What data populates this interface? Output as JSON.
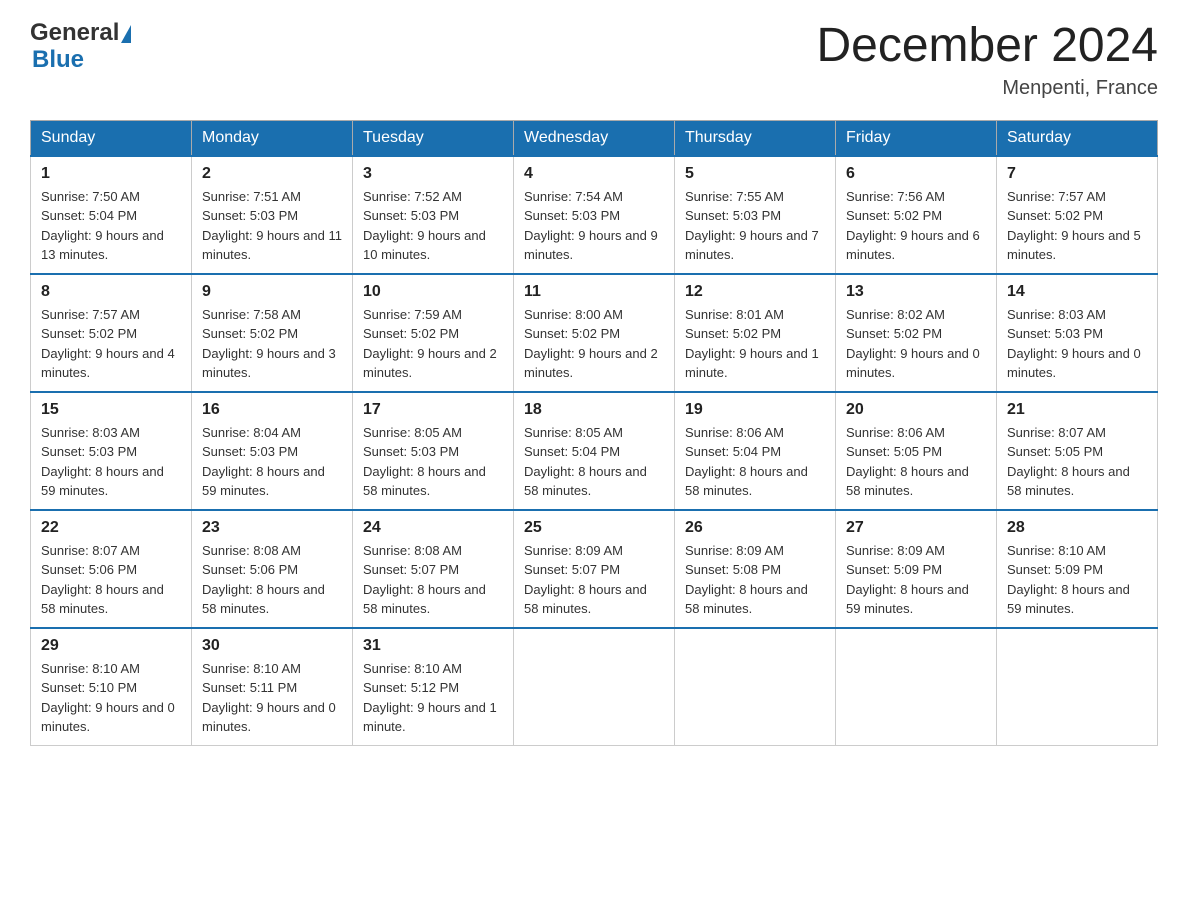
{
  "header": {
    "logo_text_general": "General",
    "logo_text_blue": "Blue",
    "title": "December 2024",
    "location": "Menpenti, France"
  },
  "days_of_week": [
    "Sunday",
    "Monday",
    "Tuesday",
    "Wednesday",
    "Thursday",
    "Friday",
    "Saturday"
  ],
  "weeks": [
    [
      {
        "date": "1",
        "sunrise": "7:50 AM",
        "sunset": "5:04 PM",
        "daylight": "9 hours and 13 minutes."
      },
      {
        "date": "2",
        "sunrise": "7:51 AM",
        "sunset": "5:03 PM",
        "daylight": "9 hours and 11 minutes."
      },
      {
        "date": "3",
        "sunrise": "7:52 AM",
        "sunset": "5:03 PM",
        "daylight": "9 hours and 10 minutes."
      },
      {
        "date": "4",
        "sunrise": "7:54 AM",
        "sunset": "5:03 PM",
        "daylight": "9 hours and 9 minutes."
      },
      {
        "date": "5",
        "sunrise": "7:55 AM",
        "sunset": "5:03 PM",
        "daylight": "9 hours and 7 minutes."
      },
      {
        "date": "6",
        "sunrise": "7:56 AM",
        "sunset": "5:02 PM",
        "daylight": "9 hours and 6 minutes."
      },
      {
        "date": "7",
        "sunrise": "7:57 AM",
        "sunset": "5:02 PM",
        "daylight": "9 hours and 5 minutes."
      }
    ],
    [
      {
        "date": "8",
        "sunrise": "7:57 AM",
        "sunset": "5:02 PM",
        "daylight": "9 hours and 4 minutes."
      },
      {
        "date": "9",
        "sunrise": "7:58 AM",
        "sunset": "5:02 PM",
        "daylight": "9 hours and 3 minutes."
      },
      {
        "date": "10",
        "sunrise": "7:59 AM",
        "sunset": "5:02 PM",
        "daylight": "9 hours and 2 minutes."
      },
      {
        "date": "11",
        "sunrise": "8:00 AM",
        "sunset": "5:02 PM",
        "daylight": "9 hours and 2 minutes."
      },
      {
        "date": "12",
        "sunrise": "8:01 AM",
        "sunset": "5:02 PM",
        "daylight": "9 hours and 1 minute."
      },
      {
        "date": "13",
        "sunrise": "8:02 AM",
        "sunset": "5:02 PM",
        "daylight": "9 hours and 0 minutes."
      },
      {
        "date": "14",
        "sunrise": "8:03 AM",
        "sunset": "5:03 PM",
        "daylight": "9 hours and 0 minutes."
      }
    ],
    [
      {
        "date": "15",
        "sunrise": "8:03 AM",
        "sunset": "5:03 PM",
        "daylight": "8 hours and 59 minutes."
      },
      {
        "date": "16",
        "sunrise": "8:04 AM",
        "sunset": "5:03 PM",
        "daylight": "8 hours and 59 minutes."
      },
      {
        "date": "17",
        "sunrise": "8:05 AM",
        "sunset": "5:03 PM",
        "daylight": "8 hours and 58 minutes."
      },
      {
        "date": "18",
        "sunrise": "8:05 AM",
        "sunset": "5:04 PM",
        "daylight": "8 hours and 58 minutes."
      },
      {
        "date": "19",
        "sunrise": "8:06 AM",
        "sunset": "5:04 PM",
        "daylight": "8 hours and 58 minutes."
      },
      {
        "date": "20",
        "sunrise": "8:06 AM",
        "sunset": "5:05 PM",
        "daylight": "8 hours and 58 minutes."
      },
      {
        "date": "21",
        "sunrise": "8:07 AM",
        "sunset": "5:05 PM",
        "daylight": "8 hours and 58 minutes."
      }
    ],
    [
      {
        "date": "22",
        "sunrise": "8:07 AM",
        "sunset": "5:06 PM",
        "daylight": "8 hours and 58 minutes."
      },
      {
        "date": "23",
        "sunrise": "8:08 AM",
        "sunset": "5:06 PM",
        "daylight": "8 hours and 58 minutes."
      },
      {
        "date": "24",
        "sunrise": "8:08 AM",
        "sunset": "5:07 PM",
        "daylight": "8 hours and 58 minutes."
      },
      {
        "date": "25",
        "sunrise": "8:09 AM",
        "sunset": "5:07 PM",
        "daylight": "8 hours and 58 minutes."
      },
      {
        "date": "26",
        "sunrise": "8:09 AM",
        "sunset": "5:08 PM",
        "daylight": "8 hours and 58 minutes."
      },
      {
        "date": "27",
        "sunrise": "8:09 AM",
        "sunset": "5:09 PM",
        "daylight": "8 hours and 59 minutes."
      },
      {
        "date": "28",
        "sunrise": "8:10 AM",
        "sunset": "5:09 PM",
        "daylight": "8 hours and 59 minutes."
      }
    ],
    [
      {
        "date": "29",
        "sunrise": "8:10 AM",
        "sunset": "5:10 PM",
        "daylight": "9 hours and 0 minutes."
      },
      {
        "date": "30",
        "sunrise": "8:10 AM",
        "sunset": "5:11 PM",
        "daylight": "9 hours and 0 minutes."
      },
      {
        "date": "31",
        "sunrise": "8:10 AM",
        "sunset": "5:12 PM",
        "daylight": "9 hours and 1 minute."
      },
      null,
      null,
      null,
      null
    ]
  ],
  "labels": {
    "sunrise": "Sunrise:",
    "sunset": "Sunset:",
    "daylight": "Daylight:"
  }
}
